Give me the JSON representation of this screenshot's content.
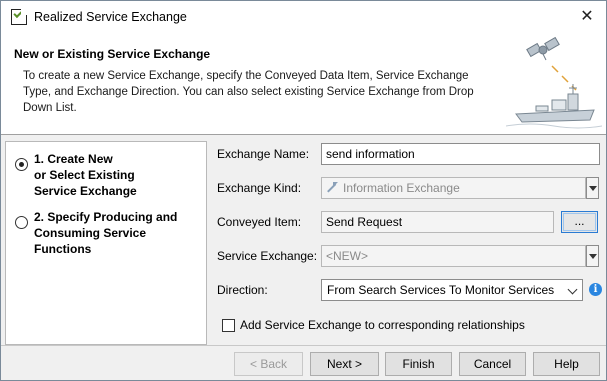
{
  "window": {
    "title": "Realized Service Exchange"
  },
  "header": {
    "title": "New or Existing Service Exchange",
    "description": "To create a new Service Exchange, specify the Conveyed Data Item, Service Exchange Type, and Exchange Direction. You can also select existing Service Exchange from Drop Down List."
  },
  "steps": [
    {
      "label_lines": [
        "1. Create New",
        "or Select Existing",
        "Service Exchange"
      ],
      "selected": true
    },
    {
      "label_lines": [
        "2. Specify Producing and",
        "Consuming Service Functions"
      ],
      "selected": false
    }
  ],
  "form": {
    "exchange_name": {
      "label": "Exchange Name:",
      "value": "send information"
    },
    "exchange_kind": {
      "label": "Exchange Kind:",
      "value": "Information Exchange"
    },
    "conveyed_item": {
      "label": "Conveyed Item:",
      "value": "Send Request",
      "browse_label": "..."
    },
    "service_exchange": {
      "label": "Service Exchange:",
      "value": "<NEW>"
    },
    "direction": {
      "label": "Direction:",
      "value": "From Search Services To Monitor Services"
    },
    "add_relationships": {
      "label": "Add Service Exchange to corresponding relationships",
      "checked": false
    }
  },
  "footer": {
    "back": "< Back",
    "next": "Next >",
    "finish": "Finish",
    "cancel": "Cancel",
    "help": "Help"
  },
  "icons": {
    "app": "check-box-icon",
    "close": "close-icon",
    "header_graphic": "satellite-ship-icon",
    "exchange_kind": "arrow-diagonal-icon",
    "info": "info-icon"
  }
}
